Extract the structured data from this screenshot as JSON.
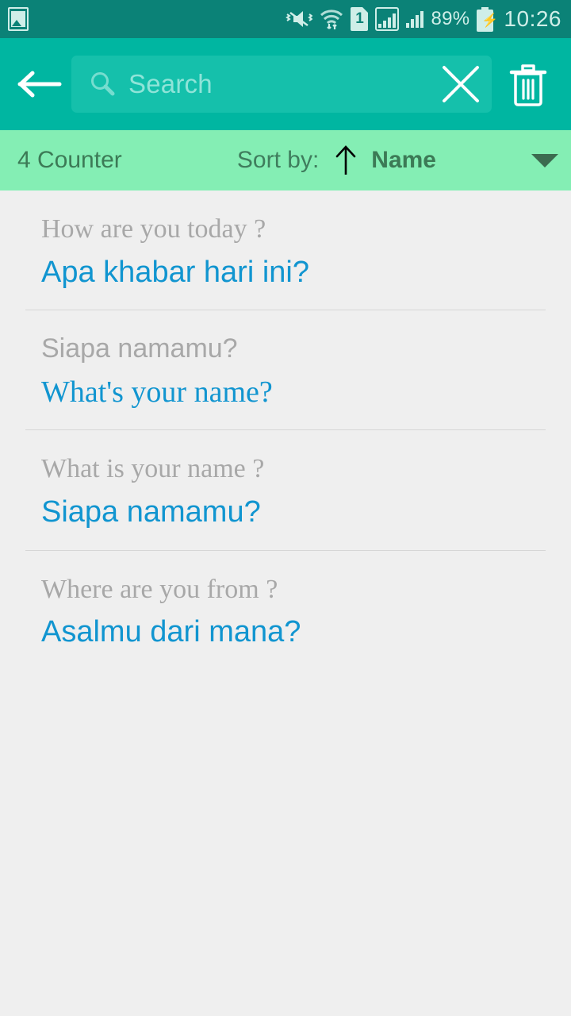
{
  "status_bar": {
    "gallery_icon": "gallery-icon",
    "mute_icon": "mute-vibrate-icon",
    "wifi_icon": "wifi-transfer-icon",
    "sim_label": "1",
    "signal_boxed_icon": "signal-bars-boxed-icon",
    "signal_icon": "signal-bars-icon",
    "battery_percent": "89%",
    "battery_icon": "battery-charging-icon",
    "time": "10:26",
    "background_color": "#0b8277",
    "foreground_color": "#cfeee8"
  },
  "toolbar": {
    "back_icon": "back-arrow-icon",
    "search_icon": "search-icon",
    "search_value": "",
    "search_placeholder": "Search",
    "clear_icon": "close-icon",
    "delete_icon": "trash-icon",
    "background_color": "#00b6a1",
    "field_color": "#15c0ab"
  },
  "sort_bar": {
    "counter": "4 Counter",
    "sort_label": "Sort by:",
    "sort_direction_icon": "arrow-up-icon",
    "sort_value": "Name",
    "dropdown_icon": "chevron-down-icon",
    "background_color": "#84eeb4",
    "text_color": "#3c7a56"
  },
  "list": {
    "source_color": "#a8a8a8",
    "target_color": "#1195d0",
    "items": [
      {
        "source": "How are you today ?",
        "target": "Apa khabar hari ini?",
        "source_font": "serif",
        "target_font": "sans"
      },
      {
        "source": "Siapa namamu?",
        "target": "What's your name?",
        "source_font": "sans",
        "target_font": "serif"
      },
      {
        "source": "What is your name ?",
        "target": "Siapa namamu?",
        "source_font": "serif",
        "target_font": "sans"
      },
      {
        "source": "Where are you from ?",
        "target": "Asalmu dari mana?",
        "source_font": "serif",
        "target_font": "sans"
      }
    ]
  }
}
